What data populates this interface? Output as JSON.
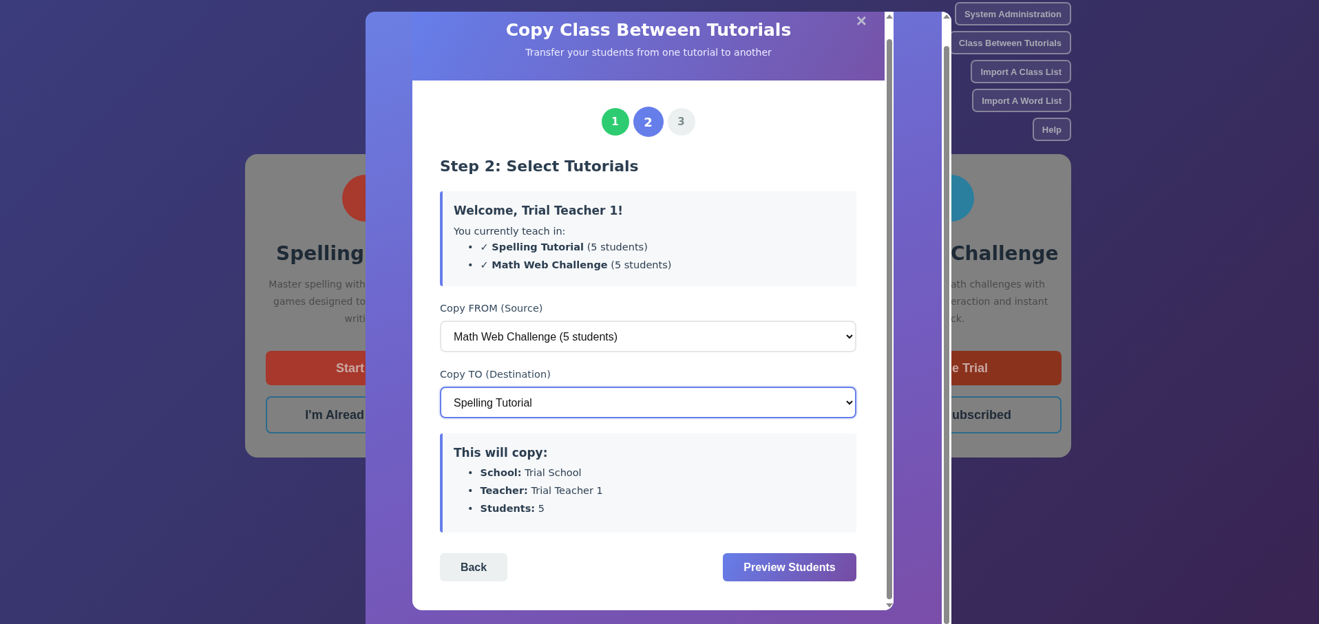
{
  "nav_buttons": [
    {
      "label": "System Administration"
    },
    {
      "label": "Class Between Tutorials"
    },
    {
      "label": "Import A Class List"
    },
    {
      "label": "Import A Word List"
    },
    {
      "label": "Help"
    }
  ],
  "cards": [
    {
      "kind": "left",
      "title": "Spelling",
      "description": [
        "Master spelling with",
        "games designed to",
        "writi"
      ],
      "primary_button": "Start",
      "secondary_button": "I'm Alread"
    },
    {
      "kind": "right",
      "title": "Challenge",
      "description": [
        "ath challenges with",
        "eraction and instant",
        "ck."
      ],
      "primary_button": "e Trial",
      "secondary_button": "ubscribed"
    }
  ],
  "modal": {
    "title": "Copy Class Between Tutorials",
    "subtitle": "Transfer your students from one tutorial to another",
    "close": "×",
    "steps": [
      {
        "label": "1",
        "done": true,
        "selected": false
      },
      {
        "label": "2",
        "done": false,
        "selected": true
      },
      {
        "label": "3",
        "done": false,
        "selected": false
      }
    ],
    "heading": "Step 2: Select Tutorials",
    "welcome": {
      "title": "Welcome, Trial Teacher 1!",
      "intro": "You currently teach in:",
      "items": [
        {
          "marker": "•",
          "text": "✓ **Spelling Tutorial** (5 students)"
        },
        {
          "marker": "•",
          "text": "✓ **Math Web Challenge** (5 students)"
        }
      ]
    },
    "fields": [
      {
        "label": "Copy FROM (Source)",
        "value": "Math Web Challenge (5 students)",
        "focused": false
      },
      {
        "label": "Copy TO (Destination)",
        "value": "Spelling Tutorial",
        "focused": true
      }
    ],
    "summary": {
      "title": "This will copy:",
      "items": [
        {
          "marker": "•",
          "text": "**School:** Trial School"
        },
        {
          "marker": "•",
          "text": "**Teacher:** Trial Teacher 1"
        },
        {
          "marker": "•",
          "text": "**Students:** 5"
        }
      ]
    },
    "back_button": "Back",
    "next_button": "Preview Students"
  }
}
